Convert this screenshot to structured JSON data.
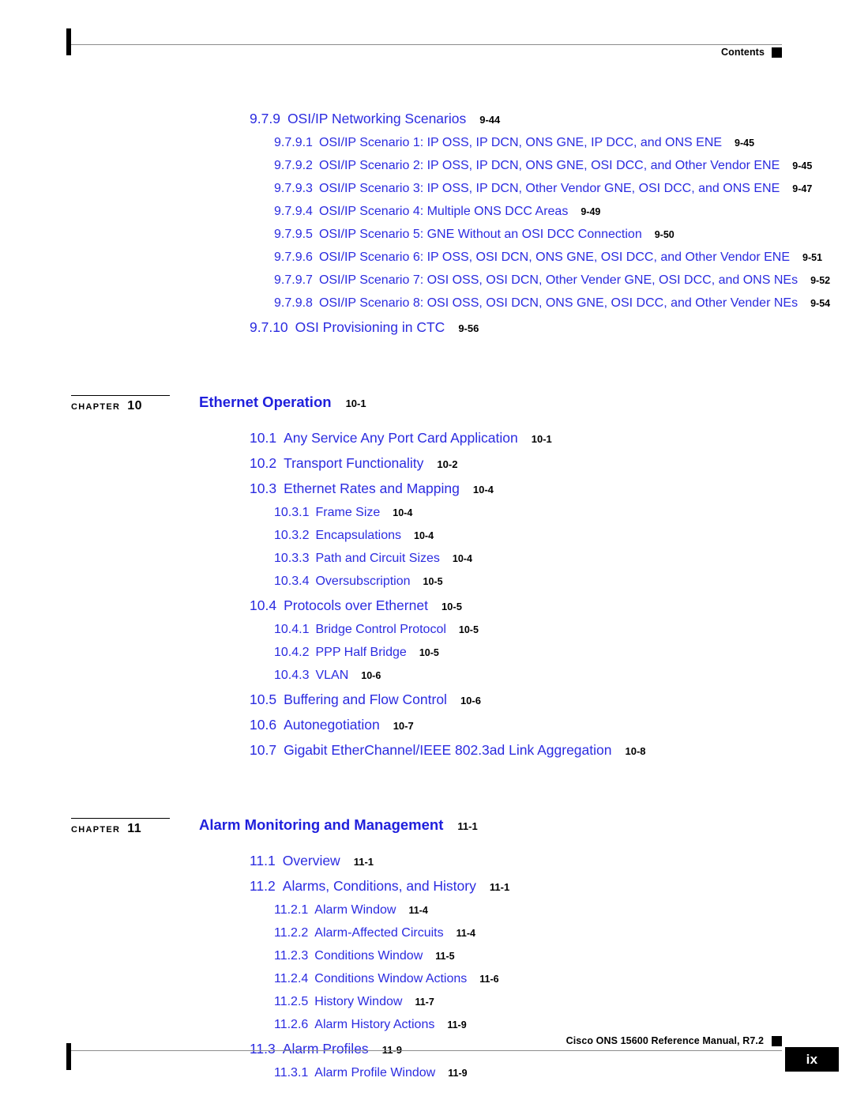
{
  "page": {
    "running_head": "Contents",
    "running_foot": "Cisco ONS 15600 Reference Manual, R7.2",
    "folio": "ix",
    "accent_blue": "#2B2BE0",
    "heading_blue": "#2020DC",
    "rule_gray": "#8c8c8c"
  },
  "toc": {
    "continued_entries": [
      {
        "level": 2,
        "num": "9.7.9",
        "title": "OSI/IP Networking Scenarios",
        "page": "9-44"
      },
      {
        "level": 3,
        "num": "9.7.9.1",
        "title": "OSI/IP Scenario 1: IP OSS, IP DCN, ONS GNE, IP DCC, and ONS ENE",
        "page": "9-45"
      },
      {
        "level": 3,
        "num": "9.7.9.2",
        "title": "OSI/IP Scenario 2: IP OSS, IP DCN, ONS GNE, OSI DCC, and Other Vendor ENE",
        "page": "9-45"
      },
      {
        "level": 3,
        "num": "9.7.9.3",
        "title": "OSI/IP Scenario 3: IP OSS, IP DCN, Other Vendor GNE, OSI DCC, and ONS ENE",
        "page": "9-47"
      },
      {
        "level": 3,
        "num": "9.7.9.4",
        "title": "OSI/IP Scenario 4: Multiple ONS DCC Areas",
        "page": "9-49"
      },
      {
        "level": 3,
        "num": "9.7.9.5",
        "title": "OSI/IP Scenario 5: GNE Without an OSI DCC Connection",
        "page": "9-50"
      },
      {
        "level": 3,
        "num": "9.7.9.6",
        "title": "OSI/IP Scenario 6: IP OSS, OSI DCN, ONS GNE, OSI DCC, and Other Vendor ENE",
        "page": "9-51"
      },
      {
        "level": 3,
        "num": "9.7.9.7",
        "title": "OSI/IP Scenario 7: OSI OSS, OSI DCN, Other Vender GNE, OSI DCC, and ONS NEs",
        "page": "9-52"
      },
      {
        "level": 3,
        "num": "9.7.9.8",
        "title": "OSI/IP Scenario 8: OSI OSS, OSI DCN, ONS GNE, OSI DCC, and Other Vender NEs",
        "page": "9-54"
      },
      {
        "level": 2,
        "num": "9.7.10",
        "title": "OSI Provisioning in CTC",
        "page": "9-56"
      }
    ],
    "chapters": [
      {
        "chapter_word": "CHAPTER",
        "chapter_no": "10",
        "title": "Ethernet Operation",
        "page": "10-1",
        "entries": [
          {
            "level": 2,
            "num": "10.1",
            "title": "Any Service Any Port Card Application",
            "page": "10-1"
          },
          {
            "level": 2,
            "num": "10.2",
            "title": "Transport Functionality",
            "page": "10-2"
          },
          {
            "level": 2,
            "num": "10.3",
            "title": "Ethernet Rates and Mapping",
            "page": "10-4"
          },
          {
            "level": 3,
            "num": "10.3.1",
            "title": "Frame Size",
            "page": "10-4"
          },
          {
            "level": 3,
            "num": "10.3.2",
            "title": "Encapsulations",
            "page": "10-4"
          },
          {
            "level": 3,
            "num": "10.3.3",
            "title": "Path and Circuit Sizes",
            "page": "10-4"
          },
          {
            "level": 3,
            "num": "10.3.4",
            "title": "Oversubscription",
            "page": "10-5"
          },
          {
            "level": 2,
            "num": "10.4",
            "title": "Protocols over Ethernet",
            "page": "10-5"
          },
          {
            "level": 3,
            "num": "10.4.1",
            "title": "Bridge Control Protocol",
            "page": "10-5"
          },
          {
            "level": 3,
            "num": "10.4.2",
            "title": "PPP Half Bridge",
            "page": "10-5"
          },
          {
            "level": 3,
            "num": "10.4.3",
            "title": "VLAN",
            "page": "10-6"
          },
          {
            "level": 2,
            "num": "10.5",
            "title": "Buffering and Flow Control",
            "page": "10-6"
          },
          {
            "level": 2,
            "num": "10.6",
            "title": "Autonegotiation",
            "page": "10-7"
          },
          {
            "level": 2,
            "num": "10.7",
            "title": "Gigabit EtherChannel/IEEE 802.3ad Link Aggregation",
            "page": "10-8"
          }
        ]
      },
      {
        "chapter_word": "CHAPTER",
        "chapter_no": "11",
        "title": "Alarm Monitoring and Management",
        "page": "11-1",
        "entries": [
          {
            "level": 2,
            "num": "11.1",
            "title": "Overview",
            "page": "11-1"
          },
          {
            "level": 2,
            "num": "11.2",
            "title": "Alarms, Conditions, and History",
            "page": "11-1"
          },
          {
            "level": 3,
            "num": "11.2.1",
            "title": "Alarm Window",
            "page": "11-4"
          },
          {
            "level": 3,
            "num": "11.2.2",
            "title": "Alarm-Affected Circuits",
            "page": "11-4"
          },
          {
            "level": 3,
            "num": "11.2.3",
            "title": "Conditions Window",
            "page": "11-5"
          },
          {
            "level": 3,
            "num": "11.2.4",
            "title": "Conditions Window Actions",
            "page": "11-6"
          },
          {
            "level": 3,
            "num": "11.2.5",
            "title": "History Window",
            "page": "11-7"
          },
          {
            "level": 3,
            "num": "11.2.6",
            "title": "Alarm History Actions",
            "page": "11-9"
          },
          {
            "level": 2,
            "num": "11.3",
            "title": "Alarm Profiles",
            "page": "11-9"
          },
          {
            "level": 3,
            "num": "11.3.1",
            "title": "Alarm Profile Window",
            "page": "11-9"
          }
        ]
      }
    ]
  }
}
